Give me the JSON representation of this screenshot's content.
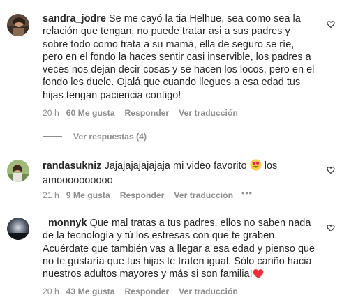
{
  "comments": [
    {
      "username": "sandra_jodre",
      "text": " Se me cayó la tia Helhue, sea como sea la relación que tengan, no puede tratar asi a sus padres y sobre todo como trata a su mamá, ella de seguro se ríe, pero en el fondo la haces sentir casi inservible, los padres a veces nos dejan decir cosas y se hacen los locos, pero en el fondo les duele. Ojalá que cuando llegues a esa edad tus hijas tengan paciencia contigo!",
      "time": "20 h",
      "likes": "60 Me gusta",
      "reply": "Responder",
      "translate": "Ver traducción",
      "view_replies": "Ver respuestas (4)"
    },
    {
      "username": "randasukniz",
      "text_before": " Jajajajajajajaja mi video favorito ",
      "text_after": " los amoooooooooo",
      "time": "21 h",
      "likes": "9 Me gusta",
      "reply": "Responder",
      "translate": "Ver traducción",
      "more": "•••",
      "emoji_icon": "heart-eyes-emoji"
    },
    {
      "username": "_monnyk",
      "text": " Que mal tratas a tus padres, ellos no saben nada de la tecnología y tú los estresas con que te graben. Acuérdate que también vas a llegar a esa edad y pienso que no te gustaría que tus hijas te traten igual. Sólo cariño hacia nuestros adultos mayores y más si son familia!",
      "time": "20 h",
      "likes": "43 Me gusta",
      "reply": "Responder",
      "translate": "Ver traducción",
      "emoji_icon": "red-heart-emoji"
    }
  ],
  "icons": {
    "like": "heart-outline-icon"
  },
  "colors": {
    "text": "#262626",
    "secondary": "#8e8e8e",
    "heart_red": "#ed2f3a",
    "emoji_yellow": "#ffcc4d"
  }
}
